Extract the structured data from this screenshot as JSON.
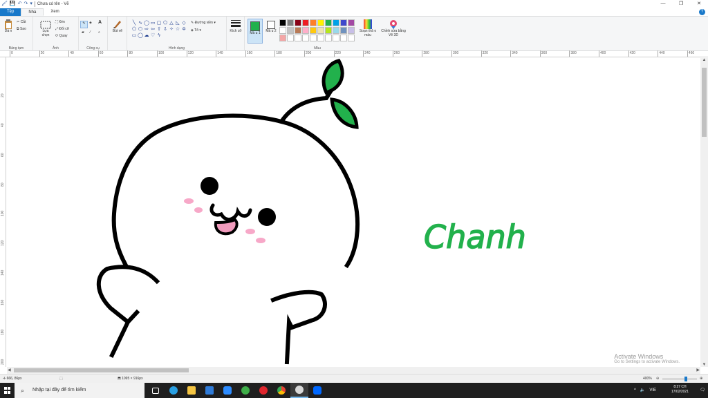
{
  "window": {
    "title": "Chưa có tên - Vẽ",
    "controls": [
      "—",
      "❐",
      "✕"
    ]
  },
  "tabs": [
    "Tệp",
    "Nhà",
    "Xem"
  ],
  "ribbon": {
    "clipboard": {
      "paste": "Dá n",
      "cut": "Cắt",
      "copy": "Sao",
      "label": "Bảng tạm"
    },
    "image": {
      "select": "Lựa chọn",
      "crop": "Xén",
      "resize": "Đổi cỡ",
      "rotate": "Quay",
      "label": "Ảnh"
    },
    "tools": {
      "label": "Công cụ"
    },
    "brushes": {
      "label": "Bút vẽ"
    },
    "shapes": {
      "outline": "Đường viền",
      "fill": "Tô",
      "label": "Hình dạng"
    },
    "size": {
      "label": "Kích cỡ"
    },
    "color1": {
      "label": "Mà u 1",
      "value": "#22b14c"
    },
    "color2": {
      "label": "Mà u 2",
      "value": "#ffffff"
    },
    "edit_colors": "Soạn thả o màu",
    "paint3d": "Chỉnh sửa bằng Vẽ 3D",
    "colors_label": "Màu",
    "palette": [
      "#000000",
      "#7f7f7f",
      "#880015",
      "#ed1c24",
      "#ff7f27",
      "#fff200",
      "#22b14c",
      "#00a2e8",
      "#3f48cc",
      "#a349a4",
      "#ffffff",
      "#c3c3c3",
      "#b97a57",
      "#ffaec9",
      "#ffc90e",
      "#efe4b0",
      "#b5e61d",
      "#99d9ea",
      "#7092be",
      "#c8bfe7",
      "#f4a6a6",
      "#ffffff",
      "#ffffff",
      "#ffffff",
      "#ffffff",
      "#ffffff",
      "#ffffff",
      "#ffffff",
      "#ffffff",
      "#ffffff"
    ]
  },
  "ruler": {
    "h_ticks": [
      "0",
      "20",
      "40",
      "60",
      "80",
      "100",
      "120",
      "140",
      "160",
      "180",
      "200",
      "220",
      "240",
      "260",
      "280",
      "300",
      "320",
      "340",
      "360",
      "380",
      "400",
      "420",
      "440",
      "460"
    ],
    "v_ticks": [
      "20",
      "40",
      "60",
      "80",
      "100",
      "120",
      "140",
      "160",
      "180",
      "200"
    ]
  },
  "canvas": {
    "text": "Chanh",
    "watermark_title": "Activate Windows",
    "watermark_sub": "Go to Settings to activate Windows."
  },
  "status": {
    "cursor": "666, 86px",
    "size": "1095 × 916px",
    "zoom": "400%"
  },
  "taskbar": {
    "search_placeholder": "Nhập tại đây để tìm kiếm",
    "lang": "VIE",
    "time": "8:27 CH",
    "date": "17/02/2021"
  }
}
